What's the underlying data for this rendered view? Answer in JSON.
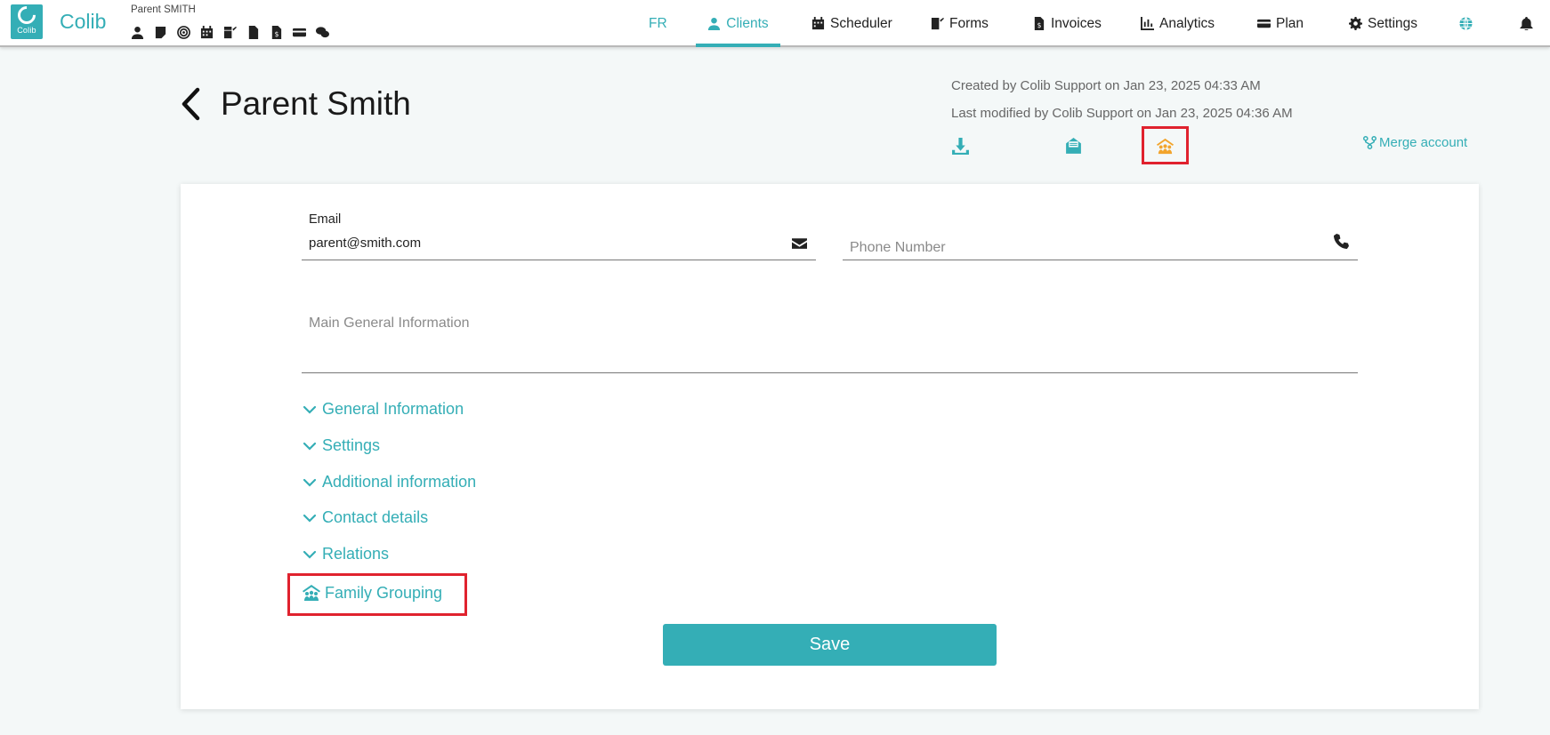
{
  "app": {
    "brand": "Colib",
    "logo_text": "Colib",
    "current_user": "Parent SMITH"
  },
  "quick_icons": [
    "user-icon",
    "note-icon",
    "target-icon",
    "calendar-icon",
    "signature-icon",
    "file-icon",
    "invoice-icon",
    "card-icon",
    "chat-icon"
  ],
  "nav": {
    "lang": "FR",
    "items": [
      {
        "label": "Clients",
        "icon": "user-icon",
        "active": true
      },
      {
        "label": "Scheduler",
        "icon": "calendar-icon"
      },
      {
        "label": "Forms",
        "icon": "signature-icon"
      },
      {
        "label": "Invoices",
        "icon": "invoice-icon"
      },
      {
        "label": "Analytics",
        "icon": "chart-icon"
      },
      {
        "label": "Plan",
        "icon": "card-icon"
      },
      {
        "label": "Settings",
        "icon": "gear-icon"
      }
    ],
    "extra_icons": [
      "globe-icon",
      "bell-icon"
    ]
  },
  "page": {
    "title": "Parent Smith",
    "created": "Created by Colib Support on Jan 23, 2025 04:33 AM",
    "modified": "Last modified by Colib Support on Jan 23, 2025 04:36 AM",
    "actions": [
      "download-icon",
      "email-open-icon",
      "family-grouping-icon"
    ],
    "merge_label": "Merge account"
  },
  "form": {
    "email": {
      "label": "Email",
      "value": "parent@smith.com"
    },
    "phone": {
      "placeholder": "Phone Number"
    },
    "main_info": {
      "placeholder": "Main General Information"
    },
    "sections": [
      "General Information",
      "Settings",
      "Additional information",
      "Contact details",
      "Relations"
    ],
    "family_grouping": "Family Grouping",
    "save_label": "Save"
  },
  "colors": {
    "accent": "#34aeb6",
    "highlight": "#e0222e",
    "family_icon": "#f2a42c"
  }
}
